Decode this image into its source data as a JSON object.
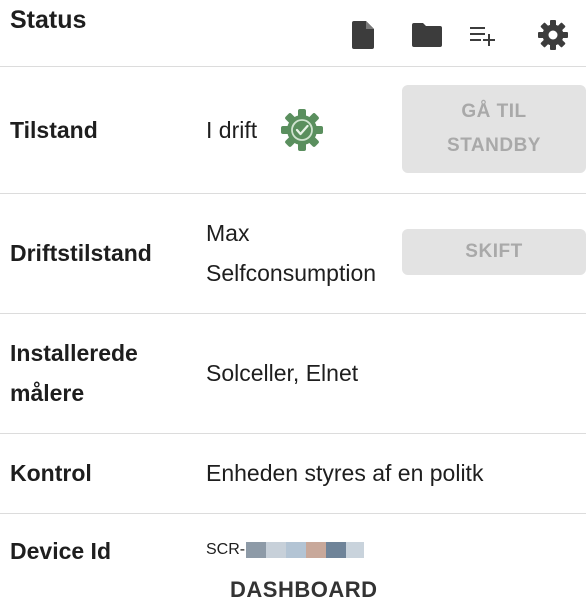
{
  "header": {
    "title": "Status",
    "icons": [
      "file-icon",
      "folder-icon",
      "playlist-add-icon",
      "gear-icon"
    ]
  },
  "rows": {
    "tilstand": {
      "label": "Tilstand",
      "value": "I drift",
      "status_icon": "gear-check-icon",
      "button": [
        "GÅ TIL",
        "STANDBY"
      ]
    },
    "driftstilstand": {
      "label": "Driftstilstand",
      "value": [
        "Max",
        "Selfconsumption"
      ],
      "button": "SKIFT"
    },
    "installerede": {
      "label": [
        "Installerede",
        "målere"
      ],
      "value": "Solceller, Elnet"
    },
    "kontrol": {
      "label": "Kontrol",
      "value": "Enheden styres af en politk"
    },
    "device_id": {
      "label": "Device Id",
      "value_prefix": "SCR-"
    }
  },
  "dashboard_link": "DASHBOARD",
  "colors": {
    "status_ok": "#5a8f5e",
    "button_bg": "#e3e3e3",
    "button_text": "#a9a9a9",
    "icon": "#3c3c3c",
    "redaction": [
      "#8d9aa7",
      "#c7d0d9",
      "#b3c4d4",
      "#cfd7de",
      "#c8a89a",
      "#b7c4cf",
      "#6f8499",
      "#c9d3dc"
    ]
  }
}
